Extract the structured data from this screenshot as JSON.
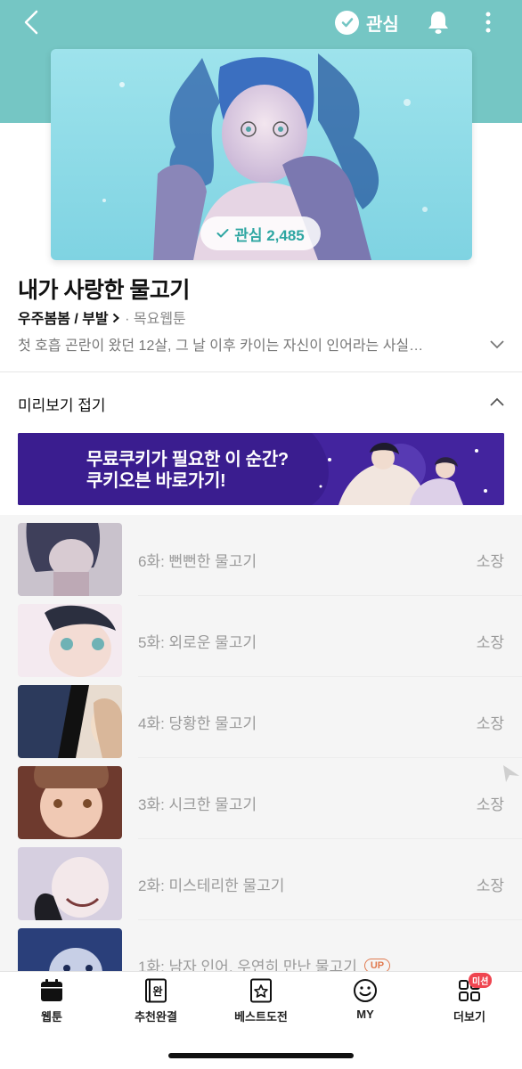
{
  "header": {
    "fav_label": "관심",
    "colors": {
      "hero_bg": "#75c6c4",
      "accent": "#2ea6a2"
    }
  },
  "cover": {
    "fav_count_label": "관심 2,485",
    "icon": "check-icon"
  },
  "info": {
    "title": "내가 사랑한 물고기",
    "author": "우주봄봄 / 부발",
    "day": "· 목요웹툰",
    "synopsis": "첫 호흡 곤란이 왔던 12살, 그 날 이후 카이는 자신이 인어라는 사실…"
  },
  "preview": {
    "label": "미리보기 접기"
  },
  "banner": {
    "line1": "무료쿠키가 필요한 이 순간?",
    "line2": "쿠키오븐 바로가기!"
  },
  "episodes": [
    {
      "title": "6화: 뻔뻔한 물고기",
      "status": "소장"
    },
    {
      "title": "5화: 외로운 물고기",
      "status": "소장"
    },
    {
      "title": "4화: 당황한 물고기",
      "status": "소장"
    },
    {
      "title": "3화: 시크한 물고기",
      "status": "소장"
    },
    {
      "title": "2화: 미스테리한 물고기",
      "status": "소장"
    },
    {
      "title": "1화: 남자 인어, 우연히 만난 물고기",
      "badge": "UP"
    }
  ],
  "bottom_nav": {
    "items": [
      {
        "label": "웹툰",
        "icon": "calendar-icon"
      },
      {
        "label": "추천완결",
        "icon": "book-complete-icon",
        "glyph": "완"
      },
      {
        "label": "베스트도전",
        "icon": "star-book-icon"
      },
      {
        "label": "MY",
        "icon": "smile-icon"
      },
      {
        "label": "더보기",
        "icon": "grid-icon",
        "badge": "미션"
      }
    ]
  }
}
